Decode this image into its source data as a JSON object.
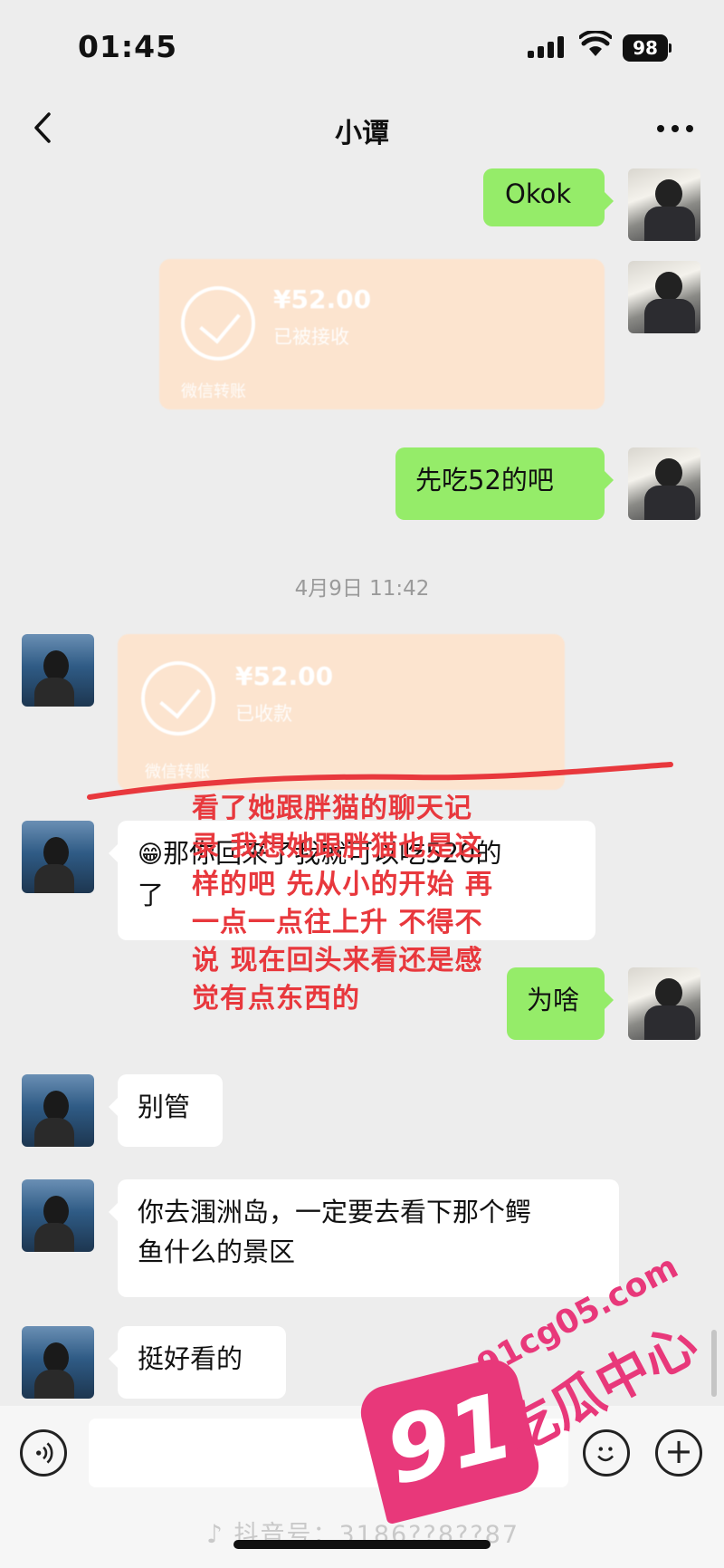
{
  "status_bar": {
    "time": "01:45",
    "battery": "98"
  },
  "nav": {
    "title": "小谭"
  },
  "messages": {
    "m1": "Okok",
    "transfer_sent": {
      "amount": "¥52.00",
      "state": "已被接收",
      "label": "微信转账"
    },
    "m3": "先吃52的吧",
    "timestamp": "4月9日 11:42",
    "transfer_received": {
      "amount": "¥52.00",
      "state": "已收款",
      "label": "微信转账"
    },
    "m5_emoji": "😁",
    "m5_line1": "那你回来了我就可以吃520的",
    "m5_line2": "了",
    "m6": "为啥",
    "m7": "别管",
    "m8_line1": "你去涠洲岛，一定要去看下那个鳄",
    "m8_line2": "鱼什么的景区",
    "m9": "挺好看的"
  },
  "annotation": {
    "lines": [
      "看了她跟胖猫的聊天记",
      "录 我想她跟胖猫也是这",
      "样的吧 先从小的开始 再",
      "一点一点往上升 不得不",
      "说 现在回头来看还是感",
      "觉有点东西的"
    ],
    "color": "#e8383d"
  },
  "footer": {
    "douyin_label": "抖音号：3186??8??87"
  },
  "watermark": {
    "number": "91",
    "domain": "91cg05.com",
    "name": "吃瓜中心",
    "color": "#e8387a"
  },
  "colors": {
    "outgoing_bubble": "#95ec69",
    "incoming_bubble": "#ffffff",
    "background": "#ededed",
    "transfer": "#fce4cf"
  }
}
